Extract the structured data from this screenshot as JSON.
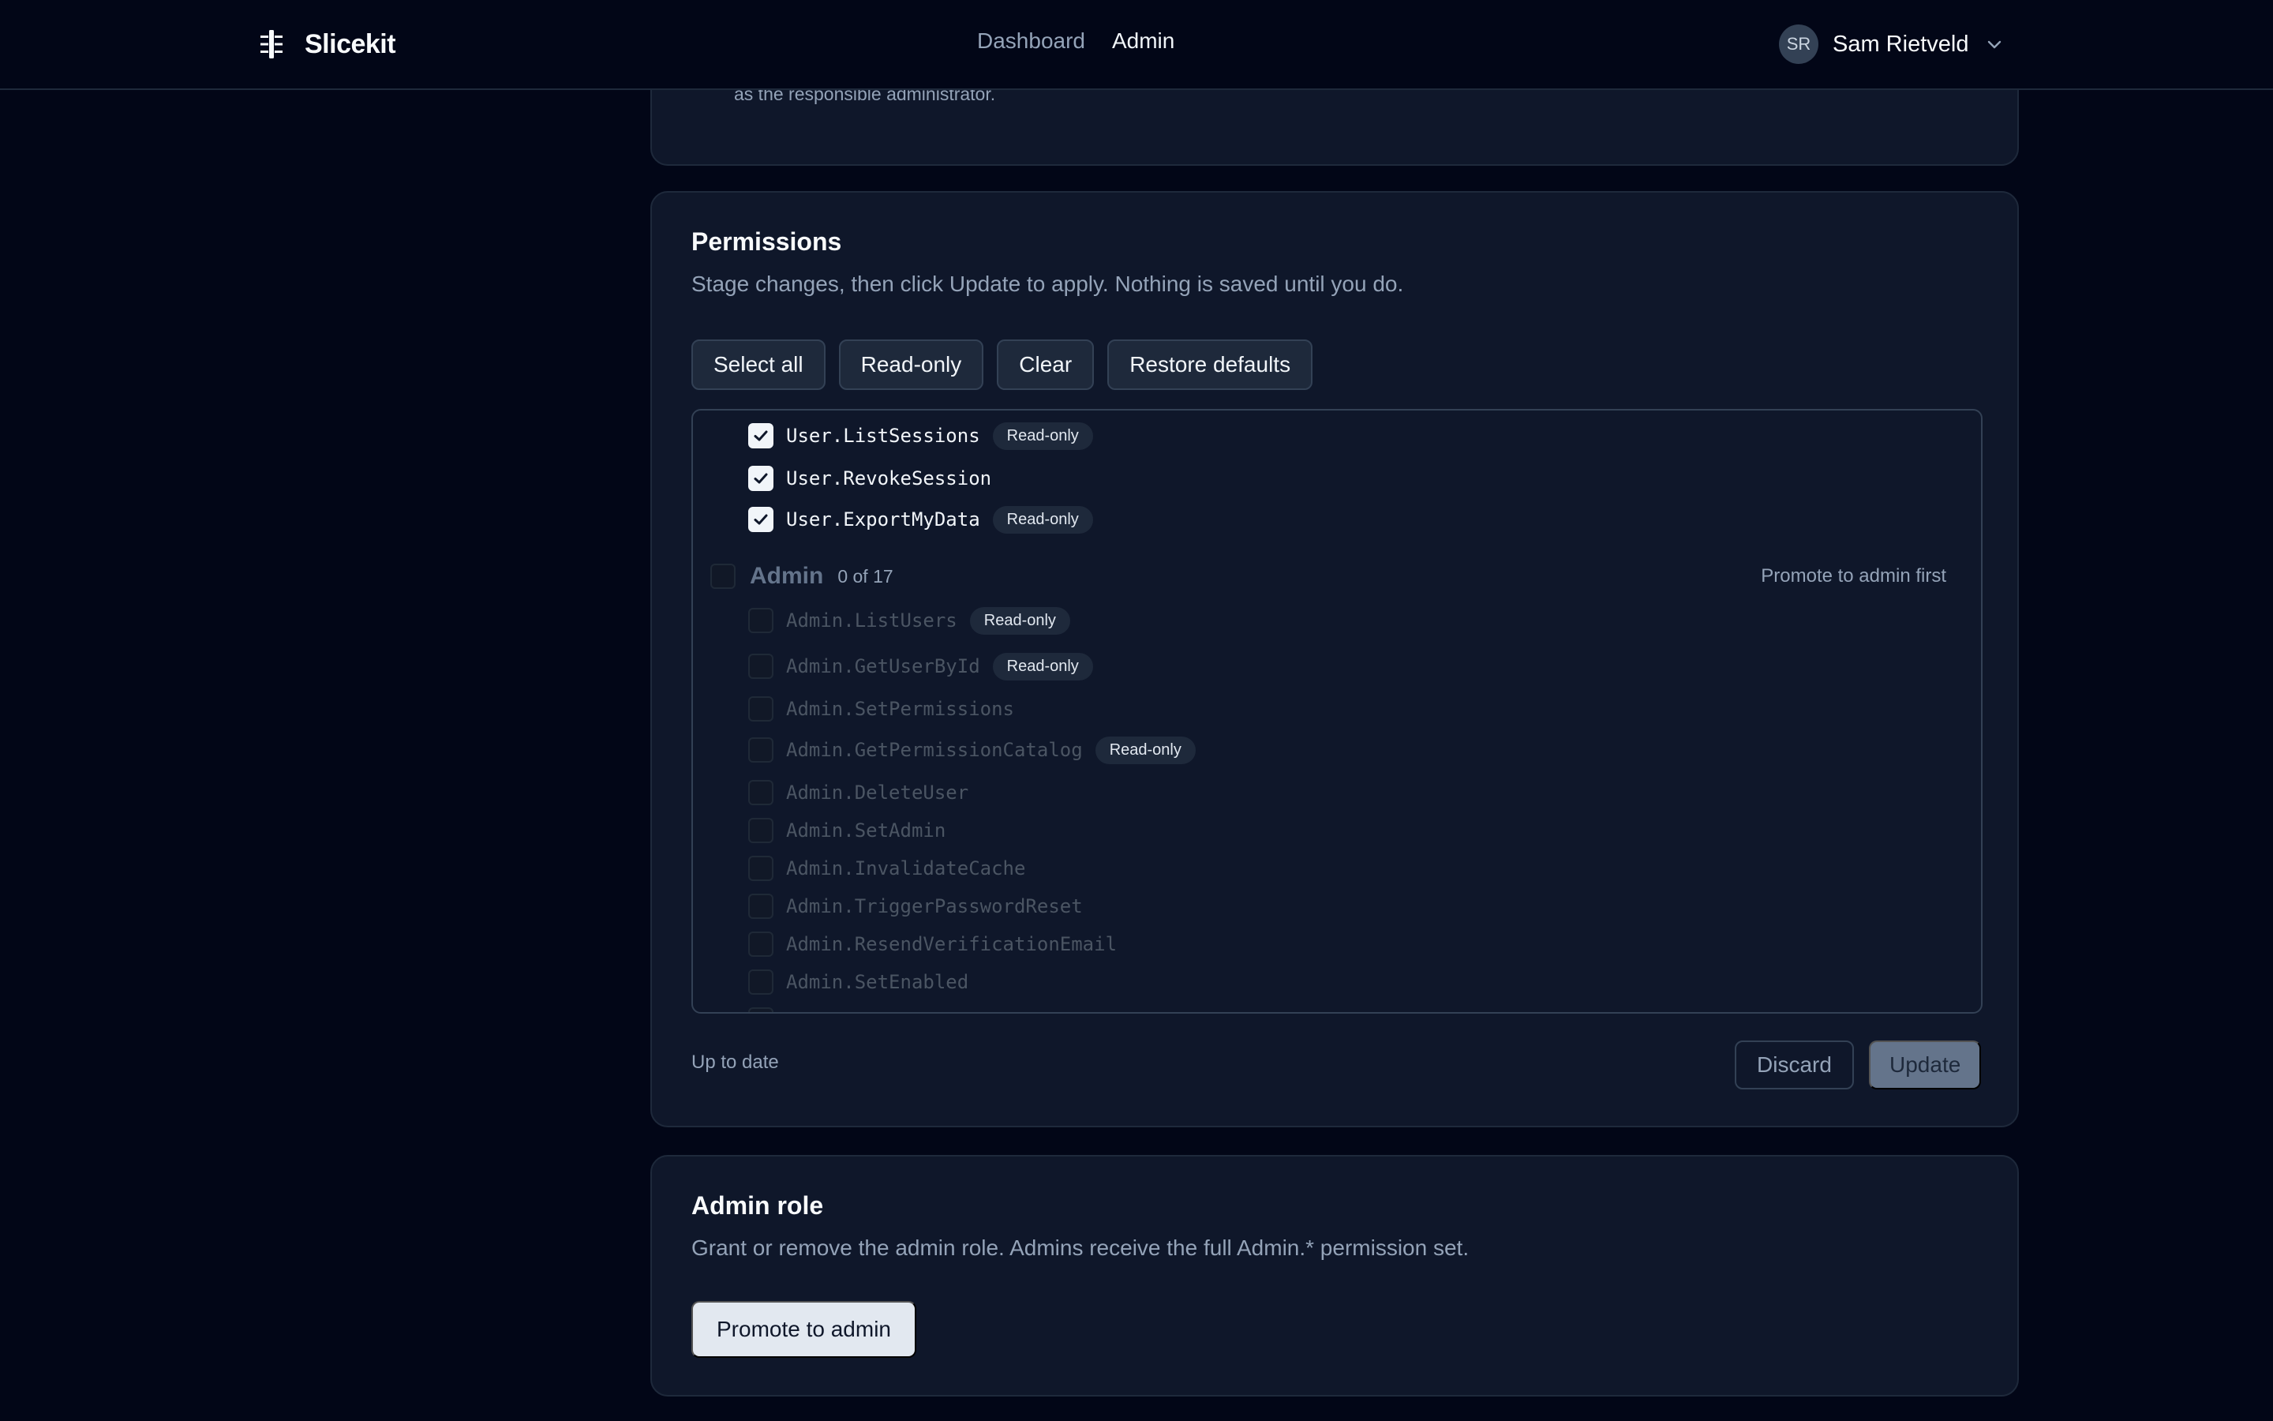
{
  "brand": {
    "name": "Slicekit",
    "icon": "slicekit-logo-icon"
  },
  "nav": {
    "items": [
      {
        "label": "Dashboard",
        "active": false
      },
      {
        "label": "Admin",
        "active": true
      }
    ]
  },
  "user": {
    "initials": "SR",
    "name": "Sam Rietveld",
    "menu_icon": "chevron-down-icon"
  },
  "top_card": {
    "note": "as the responsible administrator."
  },
  "permissions": {
    "title": "Permissions",
    "description": "Stage changes, then click Update to apply. Nothing is saved until you do.",
    "actions": {
      "select_all": "Select all",
      "read_only": "Read-only",
      "clear": "Clear",
      "restore_defaults": "Restore defaults"
    },
    "user_items": [
      {
        "name": "User.ListSessions",
        "checked": true,
        "badge": "Read-only"
      },
      {
        "name": "User.RevokeSession",
        "checked": true,
        "badge": ""
      },
      {
        "name": "User.ExportMyData",
        "checked": true,
        "badge": "Read-only"
      }
    ],
    "admin_group": {
      "name": "Admin",
      "count": "0 of 17",
      "note": "Promote to admin first",
      "checked": false
    },
    "admin_items": [
      {
        "name": "Admin.ListUsers",
        "badge": "Read-only"
      },
      {
        "name": "Admin.GetUserById",
        "badge": "Read-only"
      },
      {
        "name": "Admin.SetPermissions",
        "badge": ""
      },
      {
        "name": "Admin.GetPermissionCatalog",
        "badge": "Read-only"
      },
      {
        "name": "Admin.DeleteUser",
        "badge": ""
      },
      {
        "name": "Admin.SetAdmin",
        "badge": ""
      },
      {
        "name": "Admin.InvalidateCache",
        "badge": ""
      },
      {
        "name": "Admin.TriggerPasswordReset",
        "badge": ""
      },
      {
        "name": "Admin.ResendVerificationEmail",
        "badge": ""
      },
      {
        "name": "Admin.SetEnabled",
        "badge": ""
      }
    ],
    "status": "Up to date",
    "discard_label": "Discard",
    "update_label": "Update"
  },
  "admin_role": {
    "title": "Admin role",
    "description": "Grant or remove the admin role. Admins receive the full Admin.* permission set.",
    "promote_label": "Promote to admin"
  }
}
